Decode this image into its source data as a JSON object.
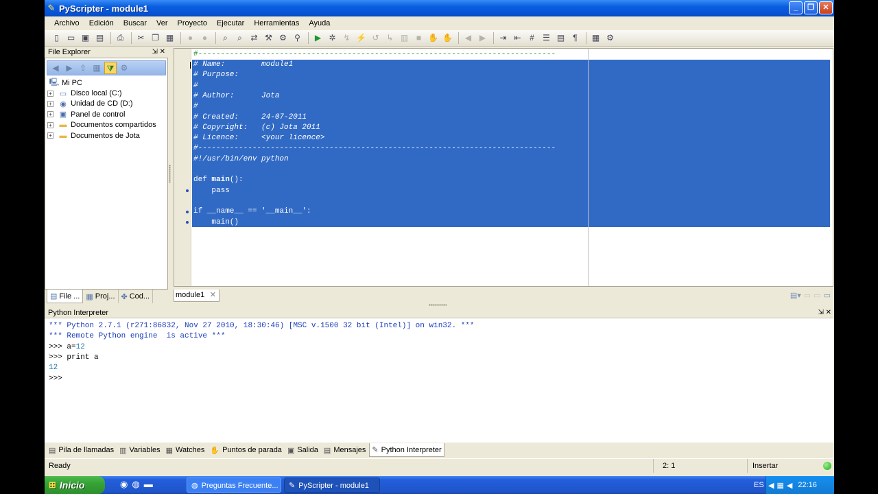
{
  "window": {
    "title": "PyScripter - module1",
    "minimize": "_",
    "maximize": "❐",
    "close": "✕"
  },
  "menu": [
    "Archivo",
    "Edición",
    "Buscar",
    "Ver",
    "Proyecto",
    "Ejecutar",
    "Herramientas",
    "Ayuda"
  ],
  "file_explorer": {
    "title": "File Explorer",
    "controls": "⇲ ✕",
    "root": "Mi PC",
    "items": [
      "Disco local (C:)",
      "Unidad de CD (D:)",
      "Panel de control",
      "Documentos compartidos",
      "Documentos de Jota"
    ]
  },
  "left_tabs": [
    "File ...",
    "Proj...",
    "Cod..."
  ],
  "editor": {
    "tab": "module1",
    "tab_close": "✕",
    "lines": [
      "#-------------------------------------------------------------------------------",
      "# Name:        module1",
      "# Purpose:",
      "#",
      "# Author:      Jota",
      "#",
      "# Created:     24-07-2011",
      "# Copyright:   (c) Jota 2011",
      "# Licence:     <your licence>",
      "#-------------------------------------------------------------------------------",
      "#!/usr/bin/env python",
      "",
      "def main():",
      "    pass",
      "",
      "if __name__ == '__main__':",
      "    main()"
    ]
  },
  "interpreter": {
    "title": "Python Interpreter",
    "controls": "⇲ ✕",
    "lines": [
      "*** Python 2.7.1 (r271:86832, Nov 27 2010, 18:30:46) [MSC v.1500 32 bit (Intel)] on win32. ***",
      "*** Remote Python engine  is active ***",
      ">>> a=12",
      ">>> print a",
      "12",
      ">>>"
    ]
  },
  "bottom_tabs": [
    "Pila de llamadas",
    "Variables",
    "Watches",
    "Puntos de parada",
    "Salida",
    "Mensajes",
    "Python Interpreter"
  ],
  "status": {
    "state": "Ready",
    "position": "2: 1",
    "mode": "Insertar"
  },
  "taskbar": {
    "start": "Inicio",
    "tasks": [
      "Preguntas Frecuente...",
      "PyScripter - module1"
    ],
    "lang": "ES",
    "clock": "22:16"
  },
  "colors": {
    "selection": "#316ac5",
    "title_bar": "#0a5ee0",
    "prompt_info": "#1b3db8"
  }
}
